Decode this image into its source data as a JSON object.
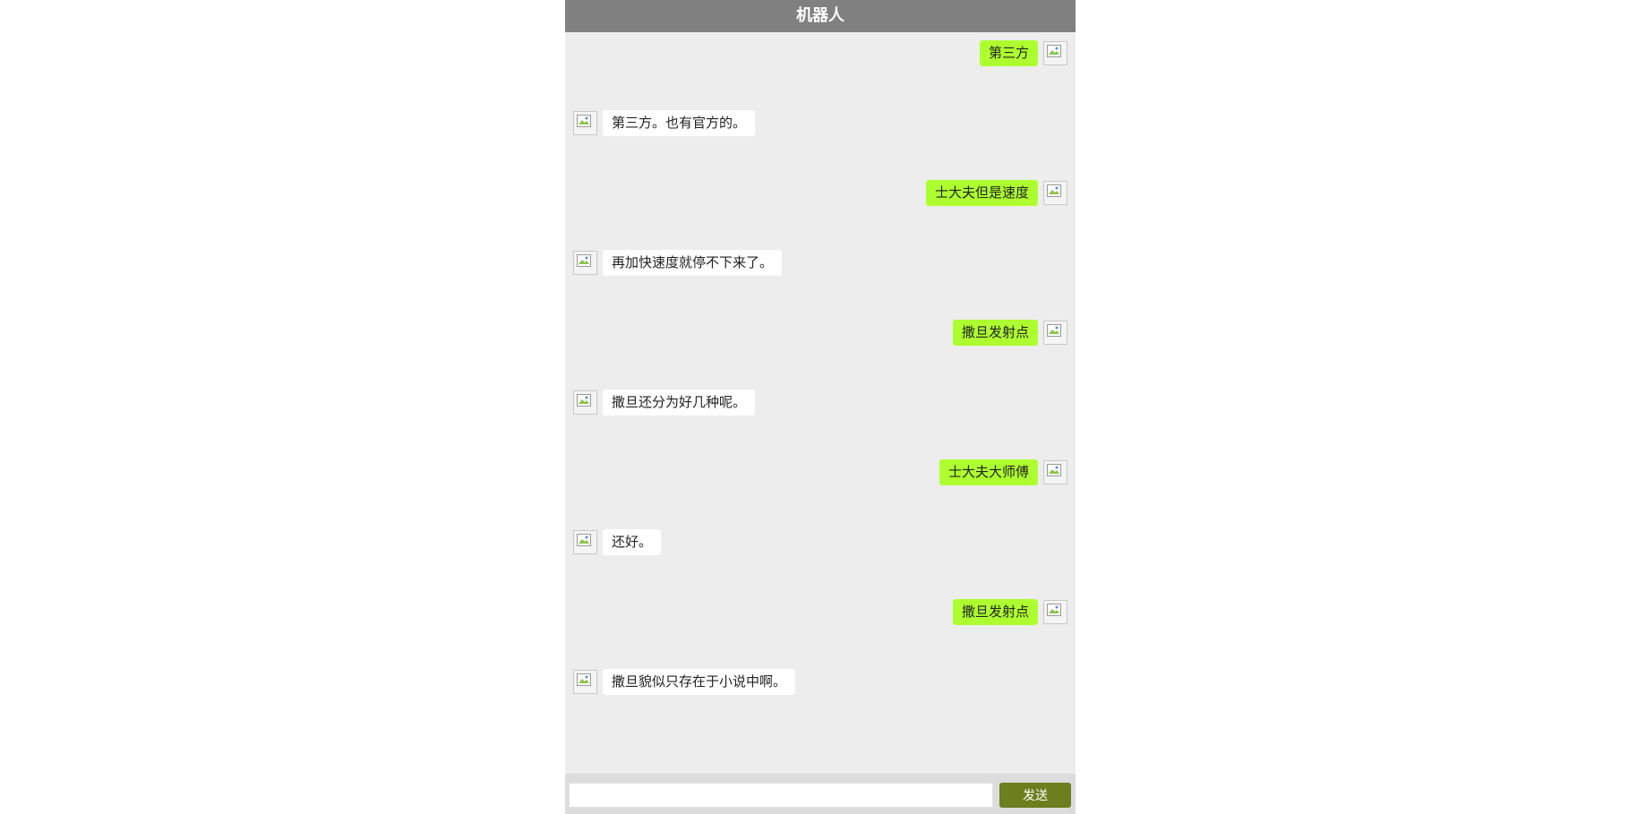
{
  "header": {
    "title": "机器人"
  },
  "messages": [
    {
      "side": "right",
      "text": "第三方"
    },
    {
      "side": "left",
      "text": "第三方。也有官方的。"
    },
    {
      "side": "right",
      "text": "士大夫但是速度"
    },
    {
      "side": "left",
      "text": "再加快速度就停不下来了。"
    },
    {
      "side": "right",
      "text": "撒旦发射点"
    },
    {
      "side": "left",
      "text": "撒旦还分为好几种呢。"
    },
    {
      "side": "right",
      "text": "士大夫大师傅"
    },
    {
      "side": "left",
      "text": "还好。"
    },
    {
      "side": "right",
      "text": "撒旦发射点"
    },
    {
      "side": "left",
      "text": "撒旦貌似只存在于小说中啊。"
    }
  ],
  "footer": {
    "input_value": "",
    "send_label": "发送"
  },
  "colors": {
    "header_bg": "#808080",
    "chat_bg": "#ededed",
    "user_bubble": "#adff2f",
    "bot_bubble": "#ffffff",
    "send_button": "#6b7f1f"
  }
}
